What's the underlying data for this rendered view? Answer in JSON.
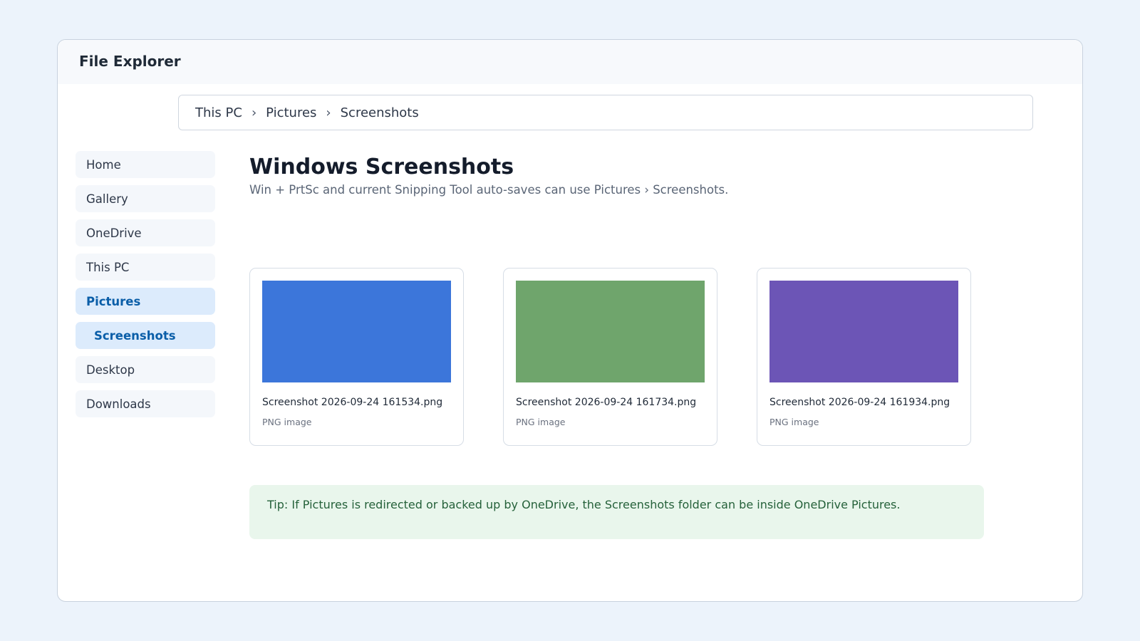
{
  "window": {
    "title": "File Explorer"
  },
  "breadcrumb": {
    "items": [
      "This PC",
      "Pictures",
      "Screenshots"
    ],
    "separator": "›"
  },
  "sidebar": {
    "items": [
      {
        "label": "Home",
        "active": false
      },
      {
        "label": "Gallery",
        "active": false
      },
      {
        "label": "OneDrive",
        "active": false
      },
      {
        "label": "This PC",
        "active": false
      },
      {
        "label": "Pictures",
        "active": true
      },
      {
        "label": "Screenshots",
        "active": true,
        "sub": true
      },
      {
        "label": "Desktop",
        "active": false
      },
      {
        "label": "Downloads",
        "active": false
      }
    ]
  },
  "main": {
    "title": "Windows Screenshots",
    "subtitle": "Win + PrtSc and current Snipping Tool auto-saves can use Pictures › Screenshots."
  },
  "files": [
    {
      "name": "Screenshot 2026-09-24 161534.png",
      "type": "PNG image",
      "thumb_color": "#3c76da"
    },
    {
      "name": "Screenshot 2026-09-24 161734.png",
      "type": "PNG image",
      "thumb_color": "#6fa56c"
    },
    {
      "name": "Screenshot 2026-09-24 161934.png",
      "type": "PNG image",
      "thumb_color": "#6c55b6"
    }
  ],
  "tip": {
    "text": "Tip: If Pictures is redirected or backed up by OneDrive, the Screenshots folder can be inside OneDrive Pictures."
  },
  "colors": {
    "accent": "#0a5ea8",
    "active_bg": "#dcebfc",
    "tip_bg": "#e9f6ec",
    "tip_text": "#25613a"
  }
}
